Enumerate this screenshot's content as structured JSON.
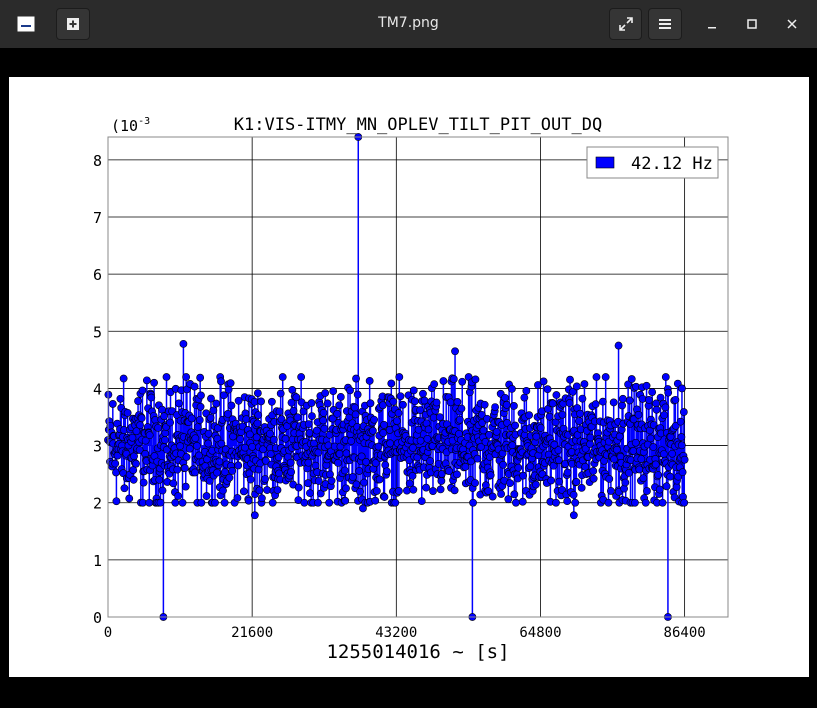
{
  "window": {
    "title": "TM7.png",
    "icons": [
      "window-icon",
      "new-window-icon",
      "fullscreen-icon",
      "menu-icon",
      "minimize-icon",
      "maximize-icon",
      "close-icon"
    ]
  },
  "colors": {
    "series": "#0000ff",
    "marker_edge": "#000000",
    "titlebar": "#2b2b2b"
  },
  "chart_data": {
    "type": "scatter",
    "title": "K1:VIS-ITMY_MN_OPLEV_TILT_PIT_OUT_DQ",
    "exponent_label": "(10",
    "exponent_sup": "-3",
    "xlabel": "1255014016 ~ [s]",
    "ylabel": "",
    "xlim": [
      0,
      92900
    ],
    "ylim": [
      0,
      8.4
    ],
    "x_ticks": [
      0,
      21600,
      43200,
      64800,
      86400
    ],
    "x_tick_labels": [
      "0",
      "21600",
      "43200",
      "64800",
      "86400"
    ],
    "y_ticks": [
      0,
      1,
      2,
      3,
      4,
      5,
      6,
      7,
      8
    ],
    "y_tick_labels": [
      "0",
      "1",
      "2",
      "3",
      "4",
      "5",
      "6",
      "7",
      "8"
    ],
    "grid": true,
    "legend": {
      "placement": "top-right",
      "entries": [
        "42.12 Hz"
      ]
    },
    "series": [
      {
        "name": "42.12 Hz",
        "style": "stem",
        "notable_points": [
          {
            "x": 8300,
            "y": 0
          },
          {
            "x": 11300,
            "y": 4.78
          },
          {
            "x": 22000,
            "y": 1.78
          },
          {
            "x": 37500,
            "y": 8.4
          },
          {
            "x": 38200,
            "y": 1.9
          },
          {
            "x": 52000,
            "y": 4.65
          },
          {
            "x": 54600,
            "y": 0
          },
          {
            "x": 54700,
            "y": 2.0
          },
          {
            "x": 69800,
            "y": 1.78
          },
          {
            "x": 76500,
            "y": 4.75
          },
          {
            "x": 83900,
            "y": 0
          },
          {
            "x": 86000,
            "y": 4.0
          }
        ],
        "bulk": {
          "x_range": [
            0,
            86400
          ],
          "typical_range": [
            2.0,
            4.2
          ],
          "center": 3.0,
          "count": 1440
        }
      }
    ]
  }
}
